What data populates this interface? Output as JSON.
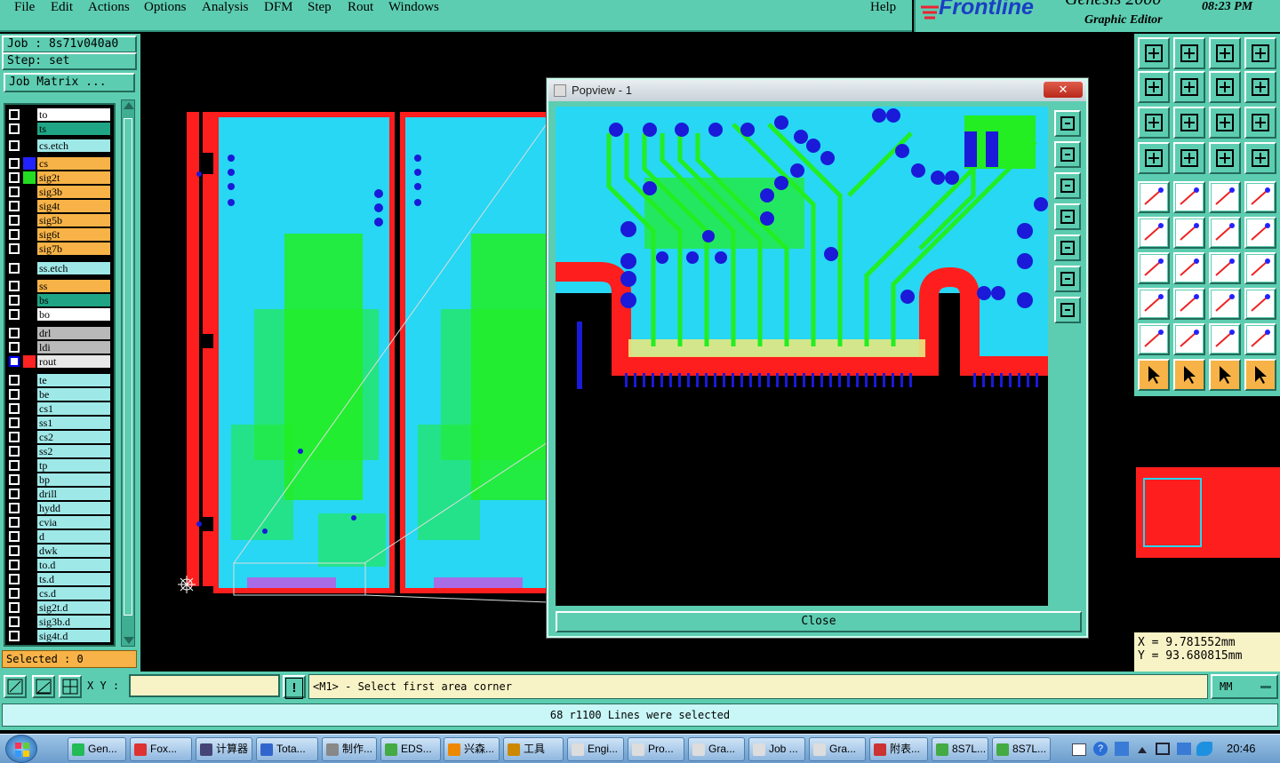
{
  "menubar": {
    "items": [
      "File",
      "Edit",
      "Actions",
      "Options",
      "Analysis",
      "DFM",
      "Step",
      "Rout",
      "Windows"
    ],
    "help": "Help"
  },
  "brand": {
    "logo": "Frontline",
    "product": "Genesis 2000",
    "subtitle": "Graphic Editor",
    "time": "08:23 PM"
  },
  "left_panel": {
    "job": "Job : 8s71v040a0",
    "step": "Step: set",
    "job_matrix_label": "Job Matrix ...",
    "layers": [
      {
        "name": "to",
        "bg": "#ffffff"
      },
      {
        "name": "ts",
        "bg": "#1fa585"
      },
      {
        "name": "cs.etch",
        "bg": "#9fe8e8"
      },
      {
        "name": "cs",
        "bg": "#f7b347",
        "chip": "#2222ff"
      },
      {
        "name": "sig2t",
        "bg": "#f7b347",
        "chip": "#22dd22"
      },
      {
        "name": "sig3b",
        "bg": "#f7b347"
      },
      {
        "name": "sig4t",
        "bg": "#f7b347"
      },
      {
        "name": "sig5b",
        "bg": "#f7b347"
      },
      {
        "name": "sig6t",
        "bg": "#f7b347"
      },
      {
        "name": "sig7b",
        "bg": "#f7b347"
      },
      {
        "name": "ss.etch",
        "bg": "#9fe8e8"
      },
      {
        "name": "ss",
        "bg": "#f7b347"
      },
      {
        "name": "bs",
        "bg": "#1fa585"
      },
      {
        "name": "bo",
        "bg": "#ffffff"
      },
      {
        "name": "drl",
        "bg": "#b9b9b9"
      },
      {
        "name": "ldi",
        "bg": "#b9b9b9"
      },
      {
        "name": "rout",
        "bg": "#e8e8e8",
        "chip": "#ff2222",
        "active": true
      },
      {
        "name": "te",
        "bg": "#9fe8e8"
      },
      {
        "name": "be",
        "bg": "#9fe8e8"
      },
      {
        "name": "cs1",
        "bg": "#9fe8e8"
      },
      {
        "name": "ss1",
        "bg": "#9fe8e8"
      },
      {
        "name": "cs2",
        "bg": "#9fe8e8"
      },
      {
        "name": "ss2",
        "bg": "#9fe8e8"
      },
      {
        "name": "tp",
        "bg": "#9fe8e8"
      },
      {
        "name": "bp",
        "bg": "#9fe8e8"
      },
      {
        "name": "drill",
        "bg": "#9fe8e8"
      },
      {
        "name": "hydd",
        "bg": "#9fe8e8"
      },
      {
        "name": "cvia",
        "bg": "#9fe8e8"
      },
      {
        "name": "d",
        "bg": "#9fe8e8"
      },
      {
        "name": "dwk",
        "bg": "#9fe8e8"
      },
      {
        "name": "to.d",
        "bg": "#9fe8e8"
      },
      {
        "name": "ts.d",
        "bg": "#9fe8e8"
      },
      {
        "name": "cs.d",
        "bg": "#9fe8e8"
      },
      {
        "name": "sig2t.d",
        "bg": "#9fe8e8"
      },
      {
        "name": "sig3b.d",
        "bg": "#9fe8e8"
      },
      {
        "name": "sig4t.d",
        "bg": "#9fe8e8"
      }
    ],
    "selected": "Selected : 0"
  },
  "popview": {
    "title": "Popview - 1",
    "close_label": "Close",
    "close_x": "✕"
  },
  "coords": {
    "x": "X = 9.781552mm",
    "y": "Y = 93.680815mm"
  },
  "status": {
    "xy_label": "X Y :",
    "xy_value": "",
    "warn": "!",
    "prompt": "<M1> - Select first area corner",
    "units": "MM",
    "message": "68 r1100 Lines were selected"
  },
  "taskbar": {
    "items": [
      "Gen...",
      "Fox...",
      "计算器",
      "Tota...",
      "制作...",
      "EDS...",
      "兴森...",
      "工具",
      "Engi...",
      "Pro...",
      "Gra...",
      "Job ...",
      "Gra...",
      "附表...",
      "8S7L...",
      "8S7L..."
    ],
    "clock": "20:46"
  },
  "colors": {
    "panel": "#5dcdb1",
    "board": "#27d7f3",
    "trace": "#22ee22",
    "pad": "#2222ff",
    "rout": "#ff1e1e",
    "highlight": "#f7b347"
  }
}
